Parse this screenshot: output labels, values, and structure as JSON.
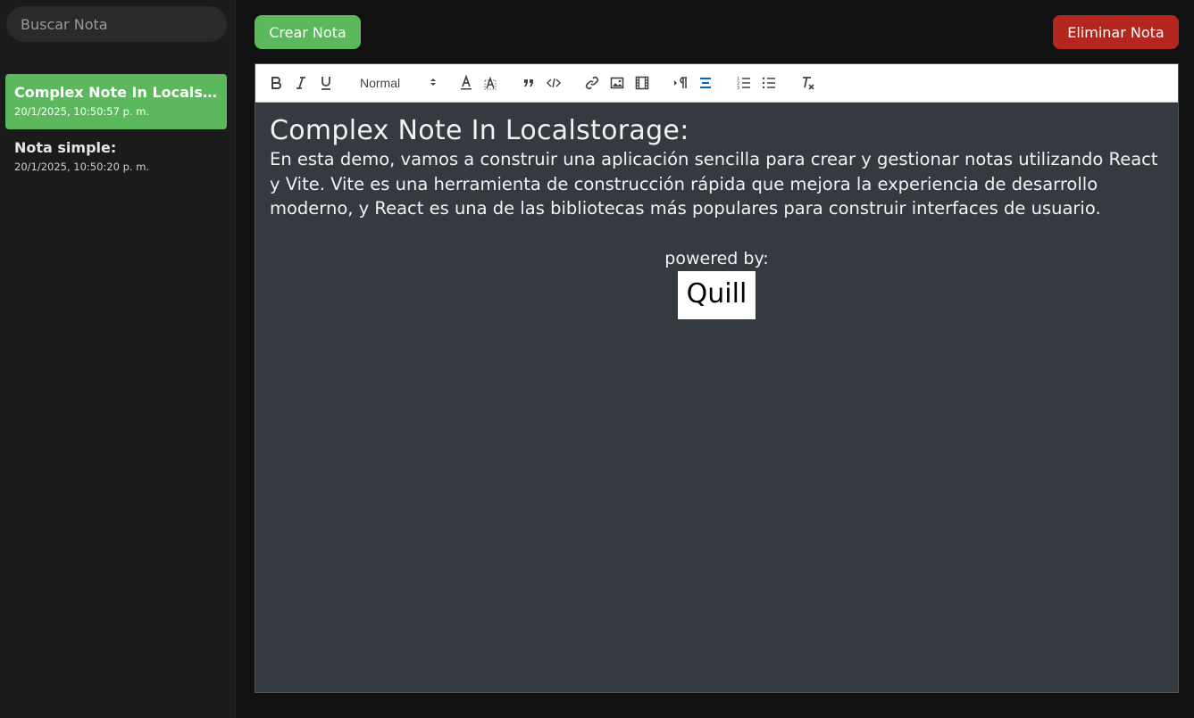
{
  "search": {
    "placeholder": "Buscar Nota",
    "value": ""
  },
  "notes": [
    {
      "title": "Complex Note In Localsto...",
      "date": "20/1/2025, 10:50:57 p. m.",
      "active": true
    },
    {
      "title": "Nota simple:",
      "date": "20/1/2025, 10:50:20 p. m.",
      "active": false
    }
  ],
  "actions": {
    "create_label": "Crear Nota",
    "delete_label": "Eliminar Nota"
  },
  "toolbar": {
    "format_value": "Normal",
    "icons": [
      "bold-icon",
      "italic-icon",
      "underline-icon",
      "text-color-icon",
      "background-color-icon",
      "blockquote-icon",
      "code-block-icon",
      "link-icon",
      "image-icon",
      "video-icon",
      "text-direction-icon",
      "align-icon",
      "ordered-list-icon",
      "bullet-list-icon",
      "clear-format-icon"
    ]
  },
  "editor": {
    "heading": "Complex Note In Localstorage:",
    "body": "En esta demo, vamos a construir una aplicación sencilla para crear y gestionar notas utilizando React y Vite. Vite es una herramienta de construcción rápida que mejora la experiencia de desarrollo moderno, y React es una de las bibliotecas más populares para construir interfaces de usuario.",
    "powered_by": "powered by:",
    "logo_text": "Quill"
  },
  "colors": {
    "accent_green": "#5cb85c",
    "danger_red": "#b3271f",
    "editor_bg": "#353940",
    "sidebar_bg": "#1b1b1b"
  }
}
